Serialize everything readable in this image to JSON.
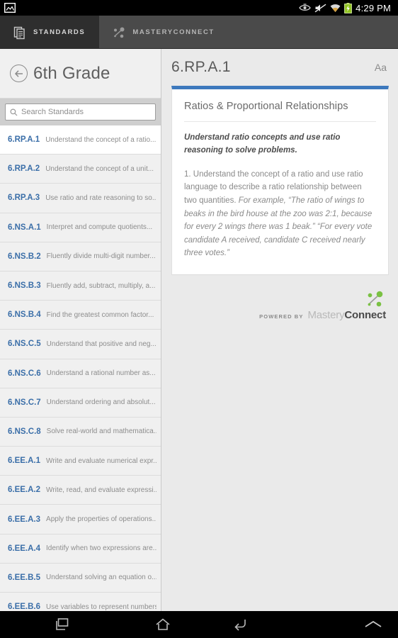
{
  "statusbar": {
    "time": "4:29 PM",
    "icons": [
      "image-icon",
      "eye-icon",
      "volume-mute-icon",
      "wifi-icon",
      "battery-charging-icon"
    ]
  },
  "tabs": [
    {
      "label": "STANDARDS",
      "icon": "documents-icon",
      "active": true
    },
    {
      "label": "MASTERYCONNECT",
      "icon": "network-nodes-icon",
      "active": false
    }
  ],
  "sidebar": {
    "back_icon": "back-arrow-icon",
    "title": "6th Grade",
    "search": {
      "placeholder": "Search Standards",
      "value": "",
      "icon": "search-icon"
    },
    "items": [
      {
        "code": "6.RP.A.1",
        "desc": "Understand the concept of a ratio...",
        "selected": true
      },
      {
        "code": "6.RP.A.2",
        "desc": "Understand the concept of a unit...",
        "selected": false
      },
      {
        "code": "6.RP.A.3",
        "desc": "Use ratio and rate reasoning to so...",
        "selected": false
      },
      {
        "code": "6.NS.A.1",
        "desc": "Interpret and compute quotients...",
        "selected": false
      },
      {
        "code": "6.NS.B.2",
        "desc": "Fluently divide multi-digit number...",
        "selected": false
      },
      {
        "code": "6.NS.B.3",
        "desc": "Fluently add, subtract, multiply, a...",
        "selected": false
      },
      {
        "code": "6.NS.B.4",
        "desc": "Find the greatest common factor...",
        "selected": false
      },
      {
        "code": "6.NS.C.5",
        "desc": "Understand that positive and neg...",
        "selected": false
      },
      {
        "code": "6.NS.C.6",
        "desc": "Understand a rational number as...",
        "selected": false
      },
      {
        "code": "6.NS.C.7",
        "desc": "Understand ordering and absolut...",
        "selected": false
      },
      {
        "code": "6.NS.C.8",
        "desc": "Solve real-world and mathematica...",
        "selected": false
      },
      {
        "code": "6.EE.A.1",
        "desc": "Write and evaluate numerical expr...",
        "selected": false
      },
      {
        "code": "6.EE.A.2",
        "desc": "Write, read, and evaluate expressi...",
        "selected": false
      },
      {
        "code": "6.EE.A.3",
        "desc": "Apply the properties of operations...",
        "selected": false
      },
      {
        "code": "6.EE.A.4",
        "desc": "Identify when two expressions are...",
        "selected": false
      },
      {
        "code": "6.EE.B.5",
        "desc": "Understand solving an equation o...",
        "selected": false
      },
      {
        "code": "6.EE.B.6",
        "desc": "Use variables to represent numbers...",
        "selected": false
      }
    ]
  },
  "content": {
    "code": "6.RP.A.1",
    "font_button": "Aa",
    "card": {
      "title": "Ratios & Proportional Relationships",
      "lead": "Understand ratio concepts and use ratio reasoning to solve problems.",
      "body_plain": "1. Understand the concept of a ratio and use ratio language to describe a ratio relationship between two quantities.",
      "body_example": " For example, “The ratio of wings to beaks in the bird house at the zoo was 2:1, because for every 2 wings there was 1 beak.” “For every vote candidate A received, candidate C received nearly three votes.”"
    },
    "footer": {
      "powered_by": "POWERED BY",
      "brand_first": "Mastery",
      "brand_second": "Connect",
      "logo_icon": "masteryconnect-nodes-icon",
      "logo_color": "#7ac143"
    },
    "accent_color": "#3d79bd"
  },
  "navbar": {
    "buttons": [
      {
        "name": "recents",
        "icon": "recents-icon"
      },
      {
        "name": "home",
        "icon": "home-icon"
      },
      {
        "name": "back",
        "icon": "back-icon"
      },
      {
        "name": "expand",
        "icon": "chevron-up-icon"
      }
    ]
  }
}
